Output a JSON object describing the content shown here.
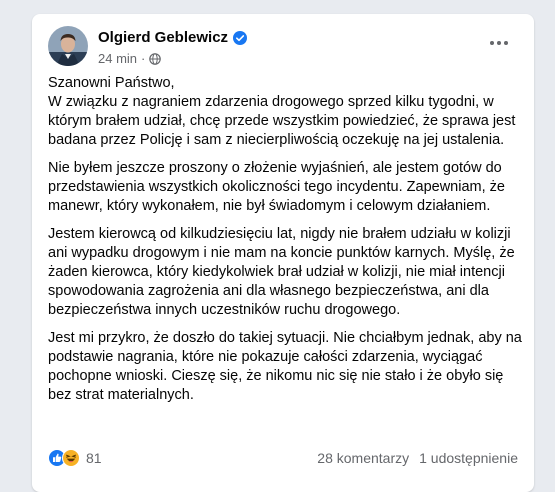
{
  "post": {
    "author": "Olgierd Geblewicz",
    "time": "24 min",
    "separator": "·",
    "paragraphs": [
      "Szanowni Państwo,\nW związku z nagraniem zdarzenia drogowego sprzed kilku tygodni, w którym brałem udział, chcę przede wszystkim powiedzieć, że sprawa jest badana przez Policję i sam z niecierpliwością oczekuję na jej ustalenia.",
      "Nie byłem jeszcze proszony o złożenie wyjaśnień, ale jestem gotów do przedstawienia wszystkich okoliczności tego incydentu. Zapewniam, że manewr, który wykonałem, nie był świadomym i celowym działaniem.",
      "Jestem kierowcą od kilkudziesięciu lat, nigdy nie brałem udziału w kolizji ani wypadku drogowym i nie mam na koncie punktów karnych. Myślę, że żaden kierowca, który kiedykolwiek brał udział w kolizji, nie miał intencji spowodowania zagrożenia ani dla własnego bezpieczeństwa, ani dla bezpieczeństwa innych uczestników ruchu drogowego.",
      "Jest mi przykro, że doszło do takiej sytuacji. Nie chciałbym jednak, aby na podstawie nagrania, które nie pokazuje całości zdarzenia, wyciągać pochopne wnioski. Cieszę się, że nikomu nic się nie stało i że obyło się bez strat materialnych."
    ]
  },
  "footer": {
    "reaction_count": "81",
    "comments": "28 komentarzy",
    "shares": "1 udostępnienie"
  },
  "colors": {
    "verified": "#1877f2",
    "like": "#1877f2",
    "haha": "#f7b125",
    "secondary_text": "#65676b"
  },
  "icons": [
    "avatar",
    "verified-badge-icon",
    "globe-icon",
    "more-options-icon",
    "like-reaction-icon",
    "haha-reaction-icon"
  ]
}
